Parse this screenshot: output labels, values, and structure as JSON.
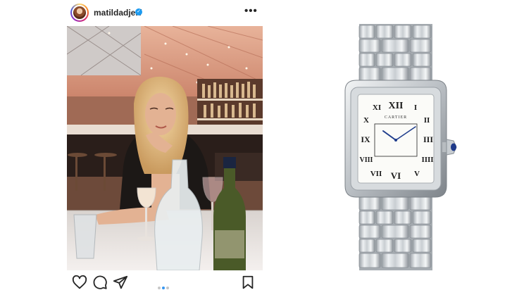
{
  "post": {
    "username": "matildadjerf",
    "verified": true,
    "more_label": "•••",
    "carousel": {
      "count": 3,
      "active_index": 1
    },
    "icons": [
      "heart-icon",
      "comment-icon",
      "share-icon",
      "bookmark-icon"
    ]
  },
  "watch": {
    "brand": "CARTIER",
    "numerals": [
      "XII",
      "I",
      "II",
      "III",
      "IIII",
      "V",
      "VI",
      "VII",
      "VIII",
      "IX",
      "X",
      "XI"
    ]
  },
  "colors": {
    "verified_badge": "#1d9bf0",
    "carousel_active": "#3897f0",
    "carousel_inactive": "#c7c7c7",
    "crown_cabochon": "#1f3a8a"
  }
}
